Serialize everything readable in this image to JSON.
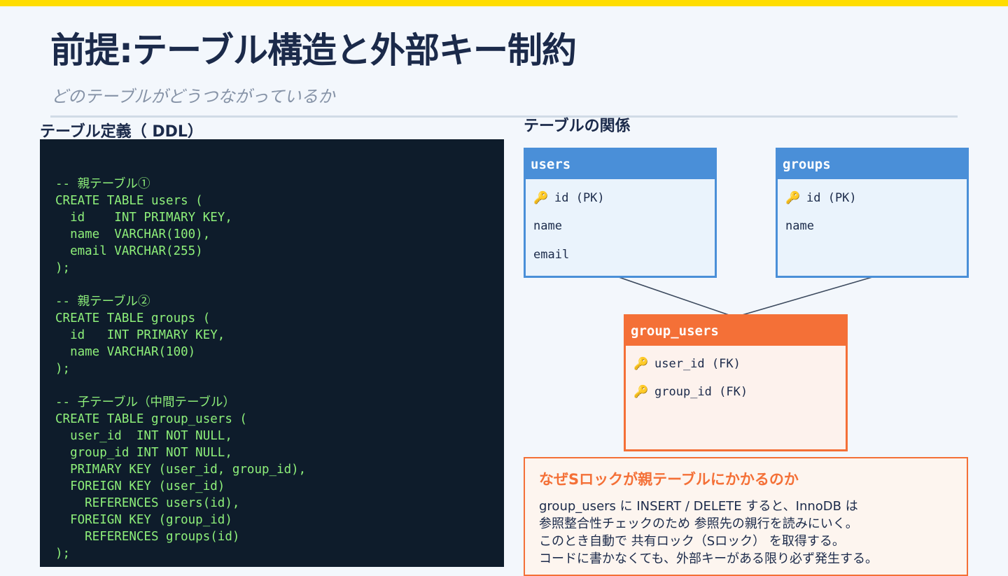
{
  "colors": {
    "accent_bar": "#ffdd00",
    "title": "#1b2a4a",
    "parent_table": "#4a8fd8",
    "child_table": "#f47037",
    "code_background": "#0e1c2b",
    "code_text": "#8ef07a"
  },
  "slide": {
    "title": "前提:テーブル構造と外部キー制約",
    "subtitle": "どのテーブルがどうつながっているか"
  },
  "ddl": {
    "label": "テーブル定義（ DDL）",
    "code": "-- 親テーブル①\nCREATE TABLE users (\n  id    INT PRIMARY KEY,\n  name  VARCHAR(100),\n  email VARCHAR(255)\n);\n\n-- 親テーブル②\nCREATE TABLE groups (\n  id   INT PRIMARY KEY,\n  name VARCHAR(100)\n);\n\n-- 子テーブル（中間テーブル）\nCREATE TABLE group_users (\n  user_id  INT NOT NULL,\n  group_id INT NOT NULL,\n  PRIMARY KEY (user_id, group_id),\n  FOREIGN KEY (user_id)\n    REFERENCES users(id),\n  FOREIGN KEY (group_id)\n    REFERENCES groups(id)\n);"
  },
  "relations": {
    "label": "テーブルの関係",
    "key_icon": "key-icon",
    "users": {
      "name": "users",
      "fields": [
        "id (PK)",
        "name",
        "email"
      ]
    },
    "groups": {
      "name": "groups",
      "fields": [
        "id (PK)",
        "name"
      ]
    },
    "group_users": {
      "name": "group_users",
      "fields": [
        "user_id (FK)",
        "group_id (FK)"
      ]
    }
  },
  "note": {
    "title": "なぜSロックが親テーブルにかかるのか",
    "lines": [
      "group_users に INSERT / DELETE すると、InnoDB は",
      "参照整合性チェックのため 参照先の親行を読みにいく。",
      "このとき自動で 共有ロック（Sロック） を取得する。",
      "コードに書かなくても、外部キーがある限り必ず発生する。"
    ]
  }
}
